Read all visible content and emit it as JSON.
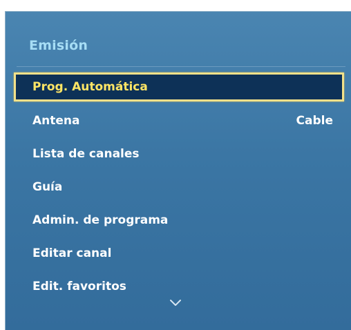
{
  "panel": {
    "title": "Emisión"
  },
  "menu": {
    "items": [
      {
        "label": "Prog. Automática",
        "value": "",
        "selected": true
      },
      {
        "label": "Antena",
        "value": "Cable",
        "selected": false
      },
      {
        "label": "Lista de canales",
        "value": "",
        "selected": false
      },
      {
        "label": "Guía",
        "value": "",
        "selected": false
      },
      {
        "label": "Admin. de programa",
        "value": "",
        "selected": false
      },
      {
        "label": "Editar canal",
        "value": "",
        "selected": false
      },
      {
        "label": "Edit. favoritos",
        "value": "",
        "selected": false
      }
    ]
  },
  "icons": {
    "scroll_down": "chevron-down-icon"
  },
  "colors": {
    "panel_background": "#3b76a4",
    "title": "#a6ddf5",
    "selected_background": "#0d3157",
    "selected_border": "#f3e18a",
    "selected_text": "#ffe565",
    "item_text": "#ffffff"
  }
}
